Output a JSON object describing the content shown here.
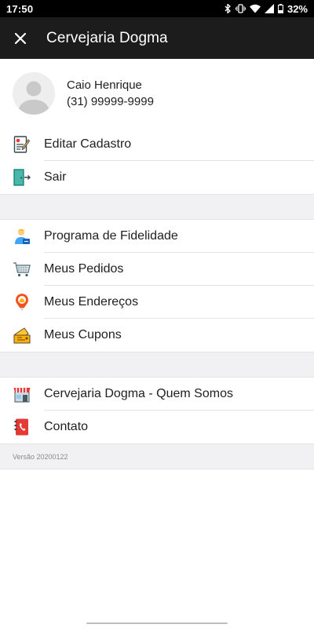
{
  "status_bar": {
    "time": "17:50",
    "battery": "32%",
    "icons": [
      "bluetooth-icon",
      "vibrate-icon",
      "wifi-icon",
      "signal-icon",
      "battery-icon"
    ]
  },
  "app_bar": {
    "title": "Cervejaria Dogma",
    "close_icon": "close-icon"
  },
  "profile": {
    "name": "Caio Henrique",
    "phone": "(31) 99999-9999"
  },
  "account_items": [
    {
      "label": "Editar Cadastro",
      "icon": "edit-form-icon"
    },
    {
      "label": "Sair",
      "icon": "exit-door-icon"
    }
  ],
  "main_items": [
    {
      "label": "Programa de Fidelidade",
      "icon": "loyalty-icon"
    },
    {
      "label": "Meus Pedidos",
      "icon": "cart-icon"
    },
    {
      "label": "Meus Endereços",
      "icon": "location-pin-icon"
    },
    {
      "label": "Meus Cupons",
      "icon": "coupon-icon"
    }
  ],
  "about_items": [
    {
      "label": "Cervejaria Dogma - Quem Somos",
      "icon": "store-icon"
    },
    {
      "label": "Contato",
      "icon": "phonebook-icon"
    }
  ],
  "version": "Versão 20200122",
  "colors": {
    "app_bar": "#1c1c1c",
    "status_bar": "#000000",
    "section_bg": "#f1f1f3",
    "divider": "#e4e4e4"
  }
}
